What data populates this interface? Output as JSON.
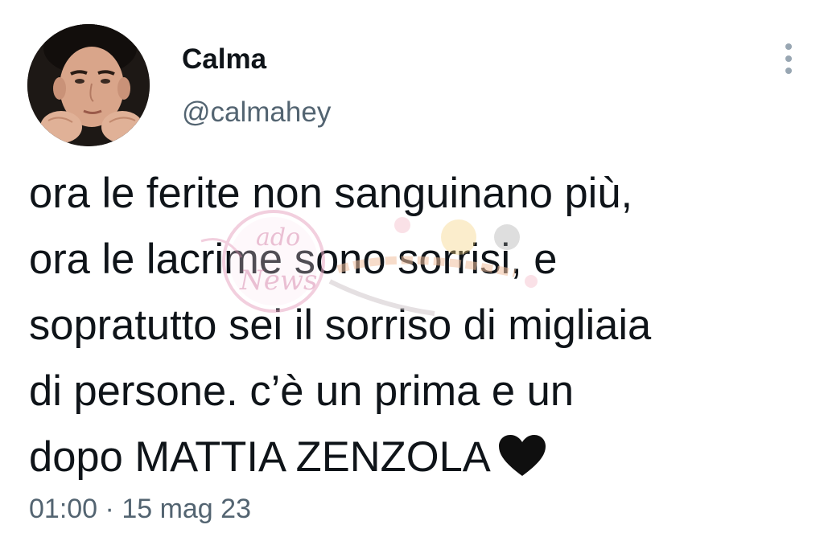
{
  "author": {
    "display_name": "Calma",
    "handle": "@calmahey",
    "avatar_icon": "profile-photo"
  },
  "more_icon": "more-vertical-icon",
  "tweet": {
    "lines": [
      "ora le ferite non sanguinano più,",
      "ora le lacrime sono sorrisi, e",
      "sopratutto sei il sorriso di migliaia",
      "di persone. c’è un prima e un",
      "dopo MATTIA ZENZOLA"
    ],
    "emoji": "black-heart-icon"
  },
  "timestamp": {
    "time": "01:00",
    "separator": " · ",
    "date": "15 mag 23"
  },
  "watermark": {
    "text_top": "ado",
    "text_bottom": "News"
  },
  "colors": {
    "text_primary": "#0f1419",
    "text_secondary": "#536471",
    "background": "#ffffff",
    "watermark_pink": "#e8a9c4"
  }
}
